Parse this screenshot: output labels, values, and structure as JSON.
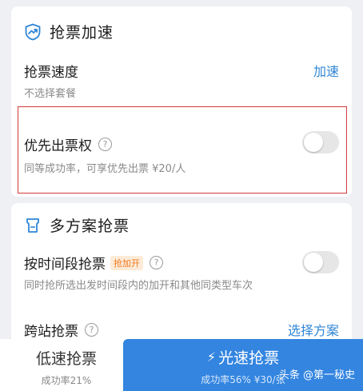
{
  "section_acceleration": {
    "title": "抢票加速",
    "speed": {
      "label": "抢票速度",
      "sub": "不选择套餐",
      "action": "加速"
    },
    "priority": {
      "label": "优先出票权",
      "help": "?",
      "sub": "同等成功率，可享优先出票 ¥20/人",
      "toggle": "off"
    }
  },
  "section_multi": {
    "title": "多方案抢票",
    "time_slot": {
      "label": "按时间段抢票",
      "badge": "抢加开",
      "help": "?",
      "sub": "同时抢所选出发时间段内的加开和其他同类型车次",
      "toggle": "off"
    },
    "cross_station": {
      "label": "跨站抢票",
      "help": "?",
      "action": "选择方案"
    }
  },
  "bottom": {
    "slow": {
      "label": "低速抢票",
      "rate": "成功率21%"
    },
    "fast": {
      "label": "光速抢票",
      "rate": "成功率56% ¥30/张"
    },
    "watermark": "头条 @第一秘史"
  },
  "colors": {
    "accent": "#3385e0",
    "link": "#2f86d6",
    "highlight": "#d23b3b",
    "badge": "#f07a1e"
  }
}
